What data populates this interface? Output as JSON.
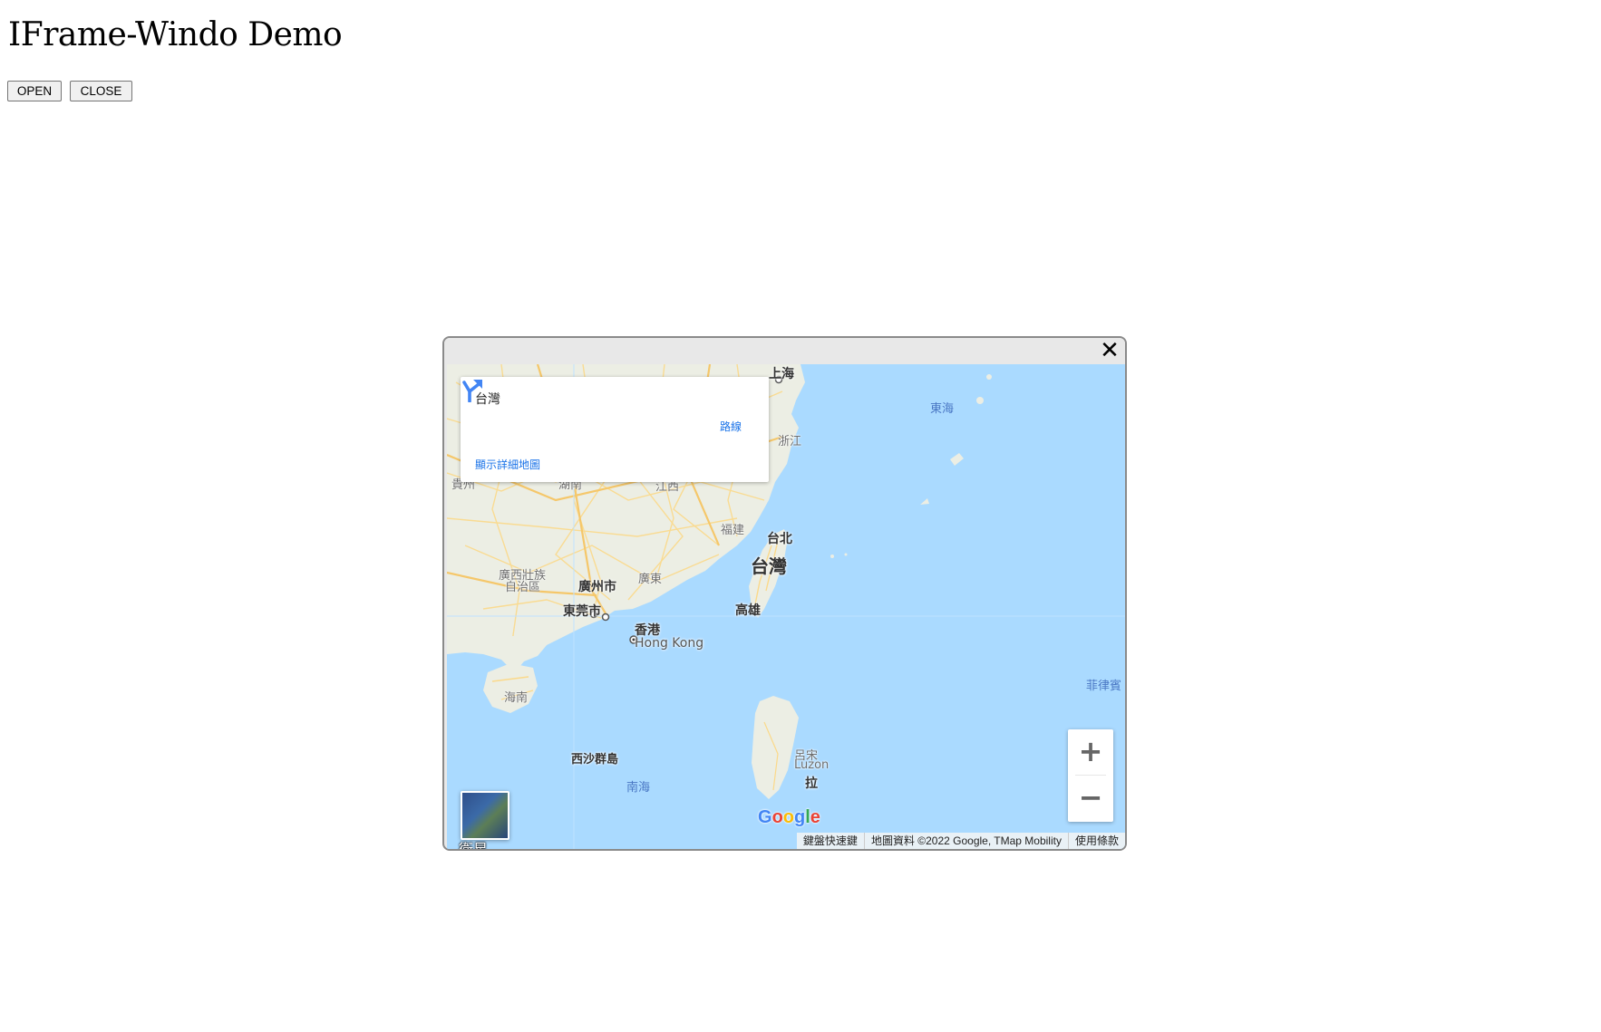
{
  "page": {
    "title": "IFrame-Windo Demo",
    "open_label": "OPEN",
    "close_label": "CLOSE"
  },
  "window": {
    "close_glyph": "✕"
  },
  "map": {
    "info_card": {
      "place": "台灣",
      "directions_label": "路線",
      "larger_map_label": "顯示詳細地圖"
    },
    "labels": {
      "shanghai": "上海",
      "east_sea": "東海",
      "zhejiang": "浙江",
      "guizhou": "貴州",
      "hunan": "湖南",
      "jiangxi": "江西",
      "fujian": "福建",
      "taipei": "台北",
      "taiwan": "台灣",
      "kaohsiung": "高雄",
      "guangxi_1": "廣西壯族",
      "guangxi_2": "自治區",
      "guangdong": "廣東",
      "guangzhou": "廣州市",
      "dongguan": "東莞市",
      "hongkong_zh": "香港",
      "hongkong_en": "Hong Kong",
      "hainan": "海南",
      "paracel": "西沙群島",
      "south_sea": "南海",
      "philippines": "菲律賓",
      "luzon_zh": "呂宋",
      "luzon_en": "Luzon",
      "luzon_city": "拉"
    },
    "layer_label": "衛星",
    "zoom_in": "+",
    "zoom_out": "−",
    "attribution": {
      "shortcuts": "鍵盤快速鍵",
      "data": "地圖資料 ©2022 Google, TMap Mobility",
      "terms": "使用條款"
    },
    "colors": {
      "water": "#aadaff",
      "land": "#eef0e6",
      "roads": "#fde293"
    }
  }
}
